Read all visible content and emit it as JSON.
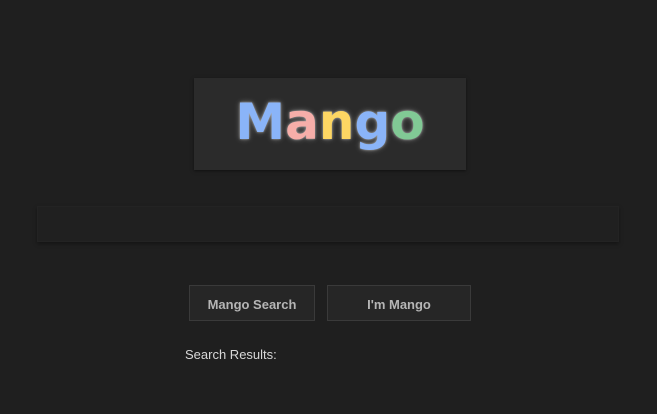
{
  "logo": {
    "letters": [
      {
        "char": "M",
        "color": "#8ab4f8"
      },
      {
        "char": "a",
        "color": "#f6aea9"
      },
      {
        "char": "n",
        "color": "#fdd663"
      },
      {
        "char": "g",
        "color": "#8ab4f8"
      },
      {
        "char": "o",
        "color": "#81c995"
      }
    ]
  },
  "search": {
    "value": "",
    "placeholder": ""
  },
  "buttons": {
    "search_label": "Mango Search",
    "lucky_label": "I'm Mango"
  },
  "results": {
    "label": "Search Results:"
  },
  "colors": {
    "background": "#1f1f1f",
    "logo_box": "#2b2b2b",
    "button_bg": "#262626",
    "button_text": "#b5b5b5"
  }
}
